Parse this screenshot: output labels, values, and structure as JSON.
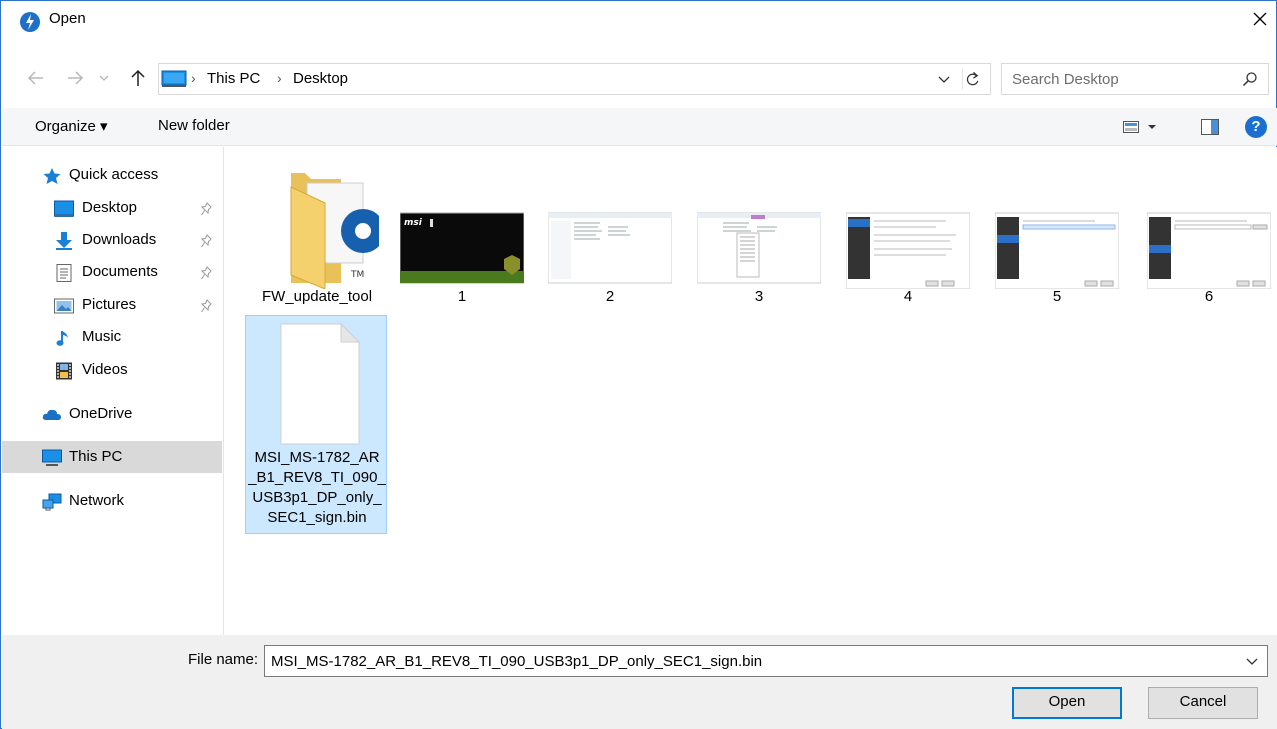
{
  "window": {
    "title": "Open",
    "close_symbol": "✕"
  },
  "address": {
    "crumbs": [
      "This PC",
      "Desktop"
    ],
    "separator": "›"
  },
  "search": {
    "placeholder": "Search Desktop"
  },
  "toolbar": {
    "organize_label": "Organize ▾",
    "new_folder_label": "New folder",
    "help_symbol": "?"
  },
  "nav": {
    "quick_access": "Quick access",
    "items": [
      {
        "label": "Desktop",
        "icon": "desktop-icon",
        "pinned": true
      },
      {
        "label": "Downloads",
        "icon": "download-arrow-icon",
        "pinned": true
      },
      {
        "label": "Documents",
        "icon": "document-icon",
        "pinned": true
      },
      {
        "label": "Pictures",
        "icon": "pictures-icon",
        "pinned": true
      },
      {
        "label": "Music",
        "icon": "music-note-icon",
        "pinned": false
      },
      {
        "label": "Videos",
        "icon": "film-icon",
        "pinned": false
      }
    ],
    "onedrive": "OneDrive",
    "this_pc": "This PC",
    "network": "Network",
    "selected": "This PC"
  },
  "files": [
    {
      "name": "FW_update_tool",
      "type": "folder"
    },
    {
      "name": "1",
      "type": "image"
    },
    {
      "name": "2",
      "type": "image"
    },
    {
      "name": "3",
      "type": "image"
    },
    {
      "name": "4",
      "type": "image"
    },
    {
      "name": "5",
      "type": "image"
    },
    {
      "name": "6",
      "type": "image"
    },
    {
      "name_lines": [
        "MSI_MS-1782_AR",
        "_B1_REV8_TI_090_",
        "USB3p1_DP_only_",
        "SEC1_sign.bin"
      ],
      "type": "file",
      "selected": true
    }
  ],
  "footer": {
    "file_name_label": "File name:",
    "file_name_value": "MSI_MS-1782_AR_B1_REV8_TI_090_USB3p1_DP_only_SEC1_sign.bin",
    "open_label": "Open",
    "cancel_label": "Cancel"
  },
  "colors": {
    "accent": "#0078d7",
    "selection_bg": "#cce8ff",
    "nav_selected_bg": "#d9d9d9",
    "window_border": "#2b74c7"
  }
}
